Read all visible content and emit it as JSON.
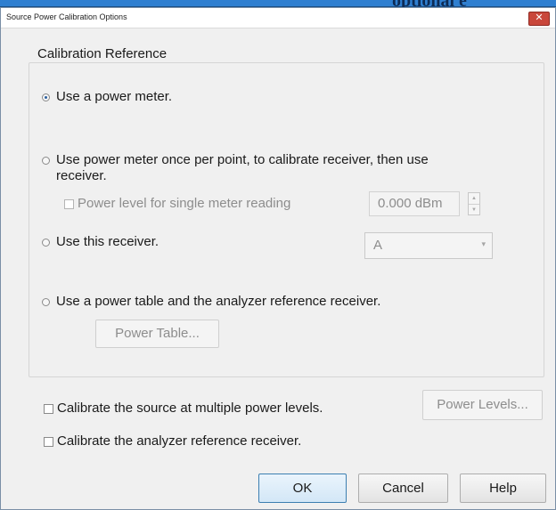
{
  "banner": {
    "overflow_text": "optional e"
  },
  "dialog": {
    "title": "Source Power Calibration Options",
    "close_glyph": "✕",
    "calibration_reference": {
      "group_label": "Calibration Reference",
      "options": [
        {
          "label": "Use a power meter.",
          "selected": true
        },
        {
          "label_line1": "Use power meter once per point, to calibrate receiver, then use",
          "label_line2": "receiver.",
          "selected": false
        },
        {
          "label": "Use this receiver.",
          "selected": false
        },
        {
          "label": "Use a power table and the analyzer reference receiver.",
          "selected": false
        }
      ],
      "single_meter": {
        "label": "Power level for single meter reading",
        "checked": false,
        "value": "0.000 dBm",
        "spin_up": "▲",
        "spin_down": "▼"
      },
      "receiver_select": {
        "value": "A",
        "arrow": "▾"
      },
      "power_table_button": "Power Table..."
    },
    "multiple_levels": {
      "label": "Calibrate the source at multiple power levels.",
      "checked": false,
      "button": "Power Levels..."
    },
    "reference_receiver": {
      "label": "Calibrate the analyzer reference receiver.",
      "checked": false
    },
    "buttons": {
      "ok": "OK",
      "cancel": "Cancel",
      "help": "Help"
    }
  }
}
